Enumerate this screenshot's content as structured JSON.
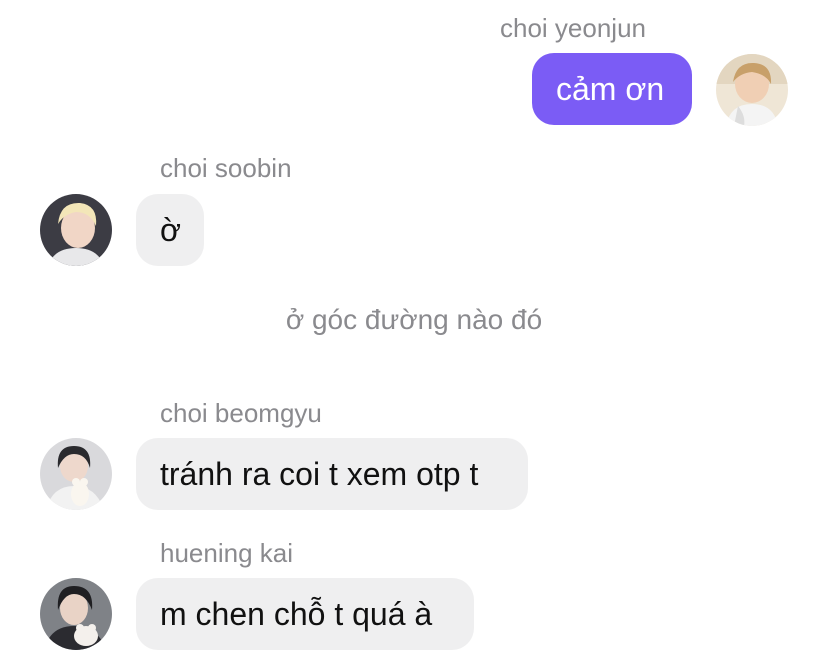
{
  "messages": [
    {
      "sender": "choi yeonjun",
      "text": "cảm ơn",
      "direction": "outgoing",
      "avatar_icon": "avatar-photo"
    },
    {
      "sender": "choi soobin",
      "text": "ờ",
      "direction": "incoming",
      "avatar_icon": "avatar-photo"
    },
    {
      "sender": "choi beomgyu",
      "text": "tránh ra coi t xem otp t",
      "direction": "incoming",
      "avatar_icon": "avatar-photo"
    },
    {
      "sender": "huening kai",
      "text": "m chen chỗ t quá à",
      "direction": "incoming",
      "avatar_icon": "avatar-photo"
    }
  ],
  "system_message": "ở góc đường nào đó",
  "colors": {
    "outgoing_bubble": "#7b5cf5",
    "incoming_bubble": "#efeff0",
    "meta_text": "#8a8a8e"
  }
}
